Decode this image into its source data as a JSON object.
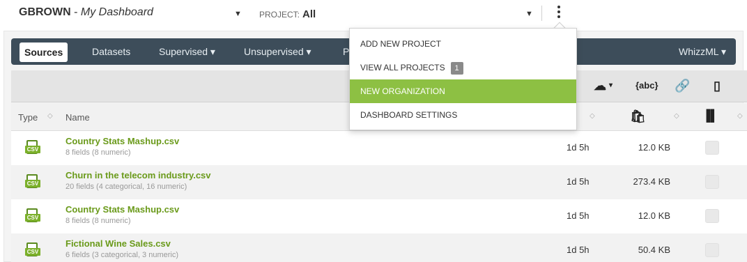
{
  "header": {
    "user": "GBROWN",
    "separator": " - ",
    "dashboard": "My Dashboard",
    "project_label": "PROJECT:",
    "project_value": "All"
  },
  "nav": {
    "items": [
      "Sources",
      "Datasets",
      "Supervised ▾",
      "Unsupervised ▾",
      "P"
    ],
    "right": "WhizzML ▾"
  },
  "menu": {
    "items": [
      {
        "label": "ADD NEW PROJECT"
      },
      {
        "label": "VIEW ALL PROJECTS",
        "badge": "1"
      },
      {
        "label": "NEW ORGANIZATION"
      },
      {
        "label": "DASHBOARD SETTINGS"
      }
    ]
  },
  "table": {
    "columns": [
      "Type",
      "Name"
    ],
    "rows": [
      {
        "name": "Country Stats Mashup.csv",
        "desc": "8 fields (8 numeric)",
        "age": "1d 5h",
        "size": "12.0 KB",
        "type": "csv"
      },
      {
        "name": "Churn in the telecom industry.csv",
        "desc": "20 fields (4 categorical, 16 numeric)",
        "age": "1d 5h",
        "size": "273.4 KB",
        "type": "csv"
      },
      {
        "name": "Country Stats Mashup.csv",
        "desc": "8 fields (8 numeric)",
        "age": "1d 5h",
        "size": "12.0 KB",
        "type": "csv"
      },
      {
        "name": "Fictional Wine Sales.csv",
        "desc": "6 fields (3 categorical, 3 numeric)",
        "age": "1d 5h",
        "size": "50.4 KB",
        "type": "csv"
      }
    ]
  },
  "toolbar": {
    "icons": [
      "cloud-upload-icon",
      "add-text-icon",
      "add-link-icon",
      "add-file-icon"
    ],
    "abc_label": "{abc}"
  },
  "colors": {
    "navbar": "#3d4d5a",
    "accent_green": "#8dc043",
    "link_green": "#6a9a1a"
  }
}
